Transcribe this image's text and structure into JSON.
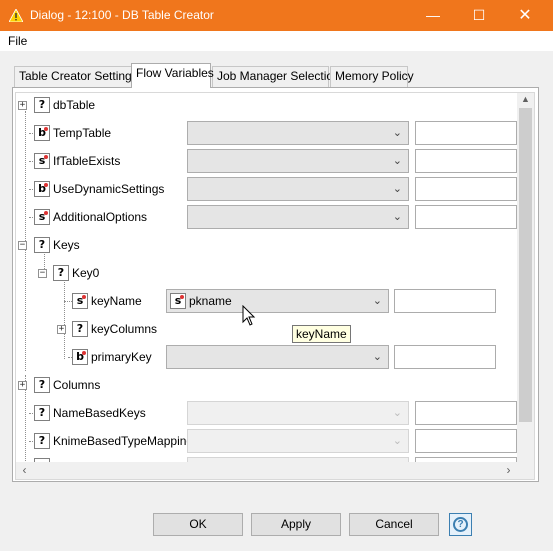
{
  "window": {
    "title": "Dialog - 12:100 - DB Table Creator",
    "minimize": "—",
    "maximize": "☐",
    "close": "✕"
  },
  "menu": {
    "file": "File"
  },
  "tabs": [
    {
      "label": "Table Creator Settings"
    },
    {
      "label": "Flow Variables"
    },
    {
      "label": "Job Manager Selection"
    },
    {
      "label": "Memory Policy"
    }
  ],
  "tree": {
    "dbTable": {
      "label": "dbTable",
      "type": "?"
    },
    "TempTable": {
      "label": "TempTable",
      "type": "b"
    },
    "IfTableExists": {
      "label": "IfTableExists",
      "type": "s"
    },
    "UseDynamicSettings": {
      "label": "UseDynamicSettings",
      "type": "b"
    },
    "AdditionalOptions": {
      "label": "AdditionalOptions",
      "type": "s"
    },
    "Keys": {
      "label": "Keys",
      "type": "?"
    },
    "Key0": {
      "label": "Key0",
      "type": "?"
    },
    "keyName": {
      "label": "keyName",
      "type": "s",
      "selected_variable": "pkname",
      "variable_type": "s"
    },
    "keyColumns": {
      "label": "keyColumns",
      "type": "?"
    },
    "primaryKey": {
      "label": "primaryKey",
      "type": "b"
    },
    "Columns": {
      "label": "Columns",
      "type": "?"
    },
    "NameBasedKeys": {
      "label": "NameBasedKeys",
      "type": "?"
    },
    "KnimeBasedTypeMapping": {
      "label": "KnimeBasedTypeMapping",
      "type": "?"
    }
  },
  "tooltip": "keyName",
  "buttons": {
    "ok": "OK",
    "apply": "Apply",
    "cancel": "Cancel",
    "help": "?"
  },
  "colors": {
    "titlebar": "#f0761c",
    "red_dot": "#d33333",
    "help_blue": "#3c7fb1"
  }
}
